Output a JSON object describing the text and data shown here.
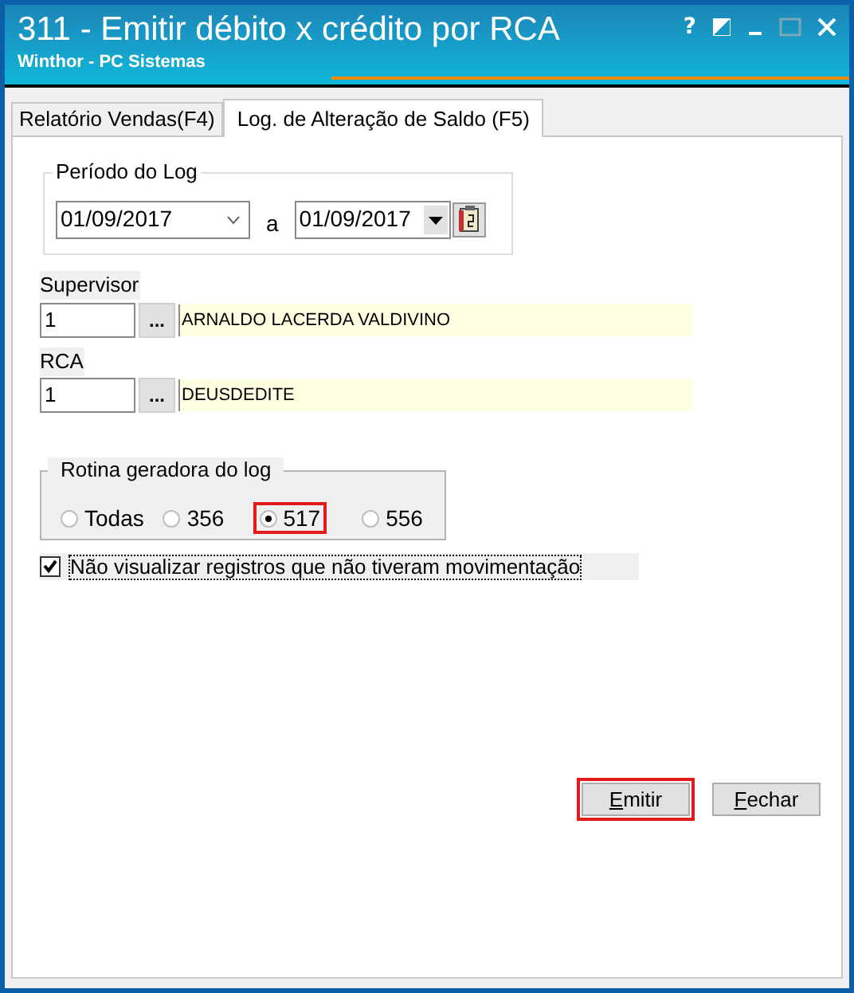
{
  "window": {
    "title": "311 - Emitir débito x crédito por RCA",
    "subtitle": "Winthor - PC Sistemas",
    "controls": [
      "?"
    ]
  },
  "tabs": [
    {
      "label": "Relatório Vendas(F4)",
      "selected": false
    },
    {
      "label": "Log. de Alteração de Saldo (F5)",
      "selected": true
    }
  ],
  "periodo": {
    "legend": "Período do Log",
    "from": "01/09/2017",
    "separator": "a",
    "to": "01/09/2017"
  },
  "supervisor": {
    "label": "Supervisor",
    "code": "1",
    "lookup": "...",
    "name": "ARNALDO LACERDA VALDIVINO"
  },
  "rca": {
    "label": "RCA",
    "code": "1",
    "lookup": "...",
    "name": "DEUSDEDITE"
  },
  "rotina": {
    "legend": "Rotina geradora do log",
    "options": [
      {
        "label": "Todas",
        "selected": false,
        "highlighted": false
      },
      {
        "label": "356",
        "selected": false,
        "highlighted": false
      },
      {
        "label": "517",
        "selected": true,
        "highlighted": true
      },
      {
        "label": "556",
        "selected": false,
        "highlighted": false
      }
    ]
  },
  "filter": {
    "label": "Não visualizar registros que não tiveram movimentação",
    "checked": true
  },
  "buttons": [
    {
      "label": "Emitir",
      "underline_first": true,
      "highlighted": true
    },
    {
      "label": "Fechar",
      "underline_first": true,
      "highlighted": false
    }
  ]
}
